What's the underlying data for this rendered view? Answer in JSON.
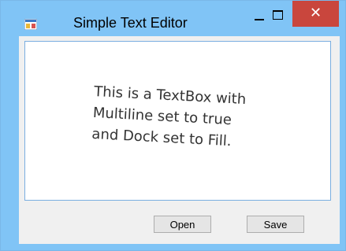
{
  "window": {
    "title": "Simple Text Editor",
    "close_glyph": "✕",
    "icons": {
      "app": "app-icon",
      "minimize": "minimize-icon",
      "maximize": "maximize-icon",
      "close": "close-icon"
    },
    "colors": {
      "titlebar": "#80c4f6",
      "close_button": "#c9463d",
      "client": "#f0f0f0",
      "textbox_border": "#7aaee0"
    }
  },
  "textbox": {
    "annotation_lines": [
      "This is a TextBox with",
      "Multiline set to true",
      "and Dock set to Fill."
    ]
  },
  "buttons": {
    "open_label": "Open",
    "save_label": "Save"
  }
}
